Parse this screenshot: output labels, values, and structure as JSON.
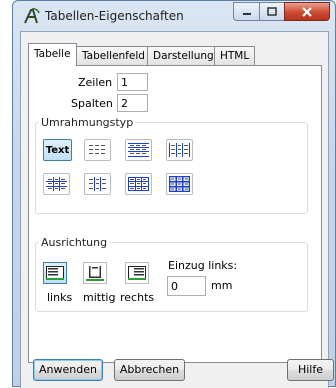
{
  "window": {
    "title": "Tabellen-Eigenschaften"
  },
  "tabs": [
    {
      "label": "Tabelle",
      "active": true
    },
    {
      "label": "Tabellenfeld",
      "active": false
    },
    {
      "label": "Darstellung",
      "active": false
    },
    {
      "label": "HTML",
      "active": false
    }
  ],
  "table": {
    "rows_label": "Zeilen",
    "rows_value": "1",
    "cols_label": "Spalten",
    "cols_value": "2"
  },
  "border_type": {
    "title": "Umrahmungstyp",
    "text_button_label": "Text",
    "options": [
      "text",
      "none",
      "outer-rows",
      "outer-cols",
      "rows-cols",
      "grid-dashed",
      "grid-outer",
      "full-grid"
    ]
  },
  "alignment": {
    "title": "Ausrichtung",
    "left_label": "links",
    "center_label": "mittig",
    "right_label": "rechts",
    "selected": "links",
    "indent_label": "Einzug links:",
    "indent_value": "0",
    "indent_unit": "mm"
  },
  "footer": {
    "apply_label": "Anwenden",
    "cancel_label": "Abbrechen",
    "help_label": "Hilfe"
  },
  "colors": {
    "accent": "#3c7fb1",
    "grid_blue": "#1d3fcf"
  }
}
